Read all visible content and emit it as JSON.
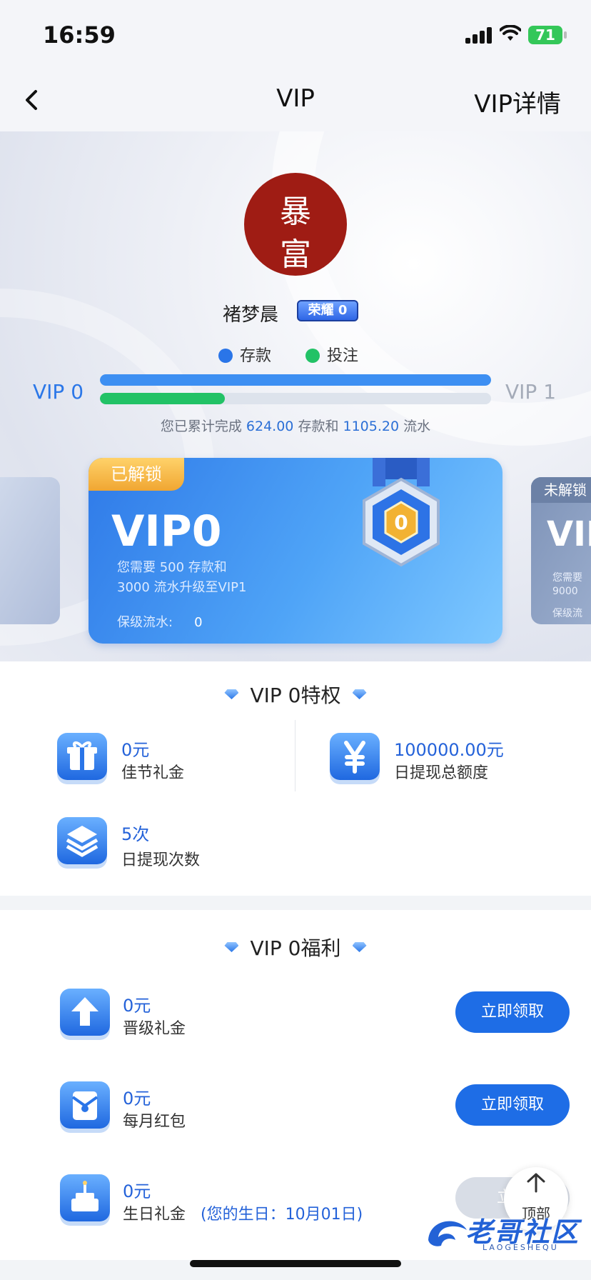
{
  "status": {
    "time": "16:59",
    "battery": "71"
  },
  "nav": {
    "title": "VIP",
    "detail": "VIP详情"
  },
  "profile": {
    "avatar_chars": [
      "暴",
      "富"
    ],
    "name": "褚梦晨",
    "honor_badge": "荣耀 0",
    "legend": [
      {
        "label": "存款",
        "color": "#2a75e8"
      },
      {
        "label": "投注",
        "color": "#22c266"
      }
    ],
    "level_current": "VIP 0",
    "level_next": "VIP 1",
    "deposit_progress": 1.0,
    "bet_progress": 0.32,
    "summary": {
      "prefix": "您已累计完成",
      "deposit": "624.00",
      "mid": "存款和",
      "turnover": "1105.20",
      "suffix": "流水"
    }
  },
  "cards": {
    "current": {
      "ribbon": "已解锁",
      "level": "VIP0",
      "medal_number": "0",
      "line1": "您需要 500 存款和",
      "line2": "3000 流水升级至VIP1",
      "keep_label": "保级流水:",
      "keep_value": "0"
    },
    "next": {
      "ribbon": "未解锁",
      "level": "VIP",
      "line1": "您需要",
      "line2": "9000",
      "line3": "保级流"
    }
  },
  "privileges": {
    "title": "VIP 0特权",
    "items": [
      {
        "value": "0元",
        "label": "佳节礼金",
        "icon": "gift-icon"
      },
      {
        "value": "100000.00元",
        "label": "日提现总额度",
        "icon": "yen-icon"
      },
      {
        "value": "5次",
        "label": "日提现次数",
        "icon": "layers-icon"
      }
    ]
  },
  "benefits": {
    "title": "VIP 0福利",
    "items": [
      {
        "value": "0元",
        "label": "晋级礼金",
        "button": "立即领取",
        "icon": "upgrade-icon"
      },
      {
        "value": "0元",
        "label": "每月红包",
        "button": "立即领取",
        "icon": "red-envelope-icon"
      },
      {
        "value": "0元",
        "label": "生日礼金",
        "note": "(您的生日：10月01日)",
        "button": "立即",
        "icon": "birthday-cake-icon"
      }
    ]
  },
  "back_to_top": "顶部",
  "watermark": {
    "text": "老哥社区",
    "sub": "LAOGESHEQU"
  }
}
